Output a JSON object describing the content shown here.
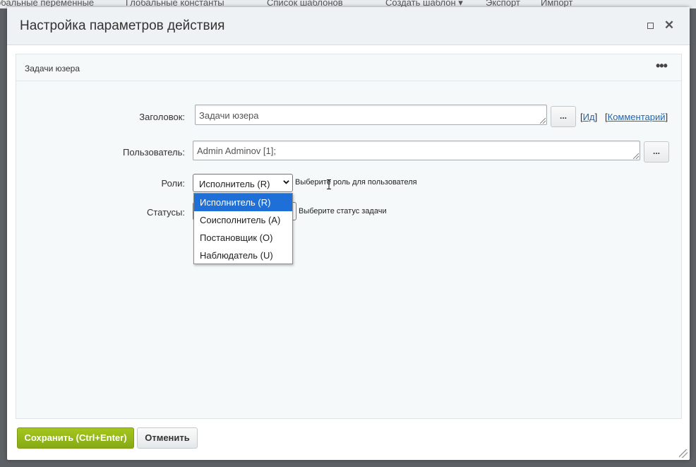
{
  "background_toolbar": {
    "items": [
      "обальные переменные",
      "Глобальные константы",
      "Список шаблонов",
      "Создать шаблон ▾",
      "Экспорт",
      "Импорт"
    ]
  },
  "dialog": {
    "title": "Настройка параметров действия",
    "panel_title": "Задачи юзера",
    "fields": {
      "title_label": "Заголовок:",
      "title_value": "Задачи юзера",
      "user_label": "Пользователь:",
      "user_value": "Admin Adminov [1];",
      "roles_label": "Роли:",
      "roles_selected": "Исполнитель (R)",
      "roles_hint": "Выберите роль для пользователя",
      "statuses_label": "Статусы:",
      "statuses_hint": "Выберите статус задачи"
    },
    "dots_button": "...",
    "links": {
      "id": "Ид",
      "comment": "Комментарий"
    },
    "roles_options": [
      "Исполнитель (R)",
      "Соисполнитель (A)",
      "Постановщик (O)",
      "Наблюдатель (U)"
    ],
    "buttons": {
      "save": "Сохранить (Ctrl+Enter)",
      "cancel": "Отменить"
    }
  },
  "colors": {
    "save_button": "#95b81a",
    "selected_option": "#1e6fd8",
    "link": "#2067b0"
  }
}
